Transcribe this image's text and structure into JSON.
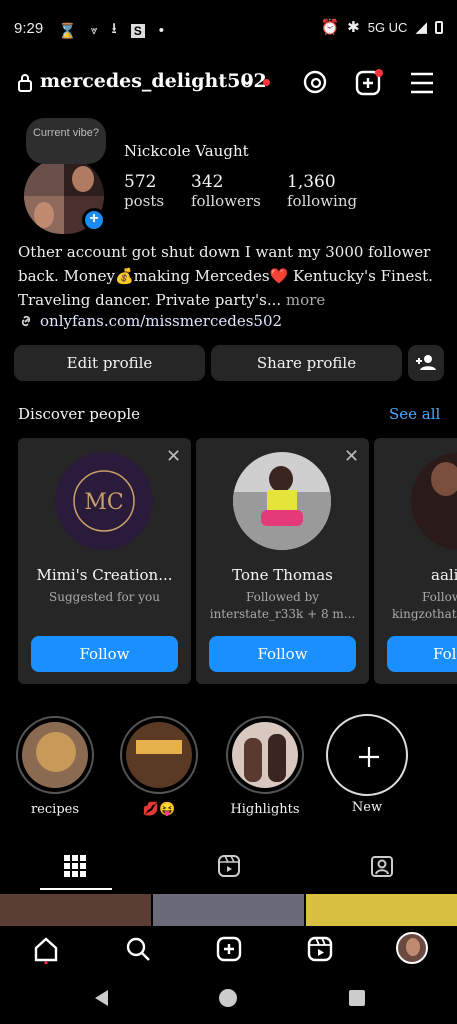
{
  "status_bar": {
    "time": "9:29",
    "network": "5G UC"
  },
  "header": {
    "username": "mercedes_delight502"
  },
  "profile": {
    "vibe_prompt": "Current vibe?",
    "display_name": "Nickcole Vaught",
    "stats": [
      {
        "value": "572",
        "label": "posts"
      },
      {
        "value": "342",
        "label": "followers"
      },
      {
        "value": "1,360",
        "label": "following"
      }
    ],
    "bio_line1": "Other account got shut down  I want my 3000 follower",
    "bio_line2": "back. Money💰making Mercedes❤️ Kentucky's Finest.",
    "bio_line3": "Traveling dancer. Private party's...",
    "bio_more": " more",
    "link": "onlyfans.com/missmercedes502"
  },
  "buttons": {
    "edit_profile": "Edit profile",
    "share_profile": "Share profile"
  },
  "discover": {
    "title": "Discover people",
    "see_all": "See all",
    "cards": [
      {
        "name": "Mimi's Creation...",
        "sub1": "Suggested for you",
        "sub2": "",
        "follow": "Follow"
      },
      {
        "name": "Tone Thomas",
        "sub1": "Followed by",
        "sub2": "interstate_r33k + 8 m...",
        "follow": "Follow"
      },
      {
        "name": "aali",
        "sub1": "Follow",
        "sub2": "kingzothat",
        "follow": "Fol"
      }
    ]
  },
  "highlights": [
    {
      "label": "recipes"
    },
    {
      "label": "💋😝"
    },
    {
      "label": "Highlights"
    },
    {
      "label": "New"
    }
  ],
  "colors": {
    "accent_blue": "#1a90ff",
    "link_blue": "#4aa8ff",
    "notification_red": "#ff3040",
    "button_dark": "#262626"
  }
}
